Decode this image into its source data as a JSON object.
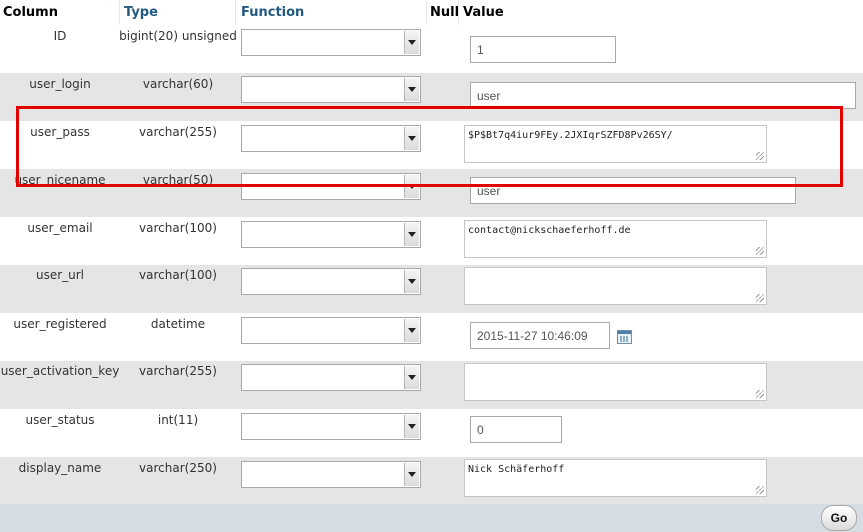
{
  "header": {
    "column": "Column",
    "type": "Type",
    "function": "Function",
    "null": "Null",
    "value": "Value"
  },
  "rows": [
    {
      "name": "ID",
      "type": "bigint(20) unsigned",
      "value": "1",
      "kind": "input"
    },
    {
      "name": "user_login",
      "type": "varchar(60)",
      "value": "user",
      "kind": "input"
    },
    {
      "name": "user_pass",
      "type": "varchar(255)",
      "value": "$P$Bt7q4iur9FEy.2JXIqrSZFD8Pv26SY/",
      "kind": "textarea"
    },
    {
      "name": "user_nicename",
      "type": "varchar(50)",
      "value": "user",
      "kind": "input"
    },
    {
      "name": "user_email",
      "type": "varchar(100)",
      "value": "contact@nickschaeferhoff.de",
      "kind": "textarea"
    },
    {
      "name": "user_url",
      "type": "varchar(100)",
      "value": "",
      "kind": "textarea"
    },
    {
      "name": "user_registered",
      "type": "datetime",
      "value": "2015-11-27 10:46:09",
      "kind": "date"
    },
    {
      "name": "user_activation_key",
      "type": "varchar(255)",
      "value": "",
      "kind": "textarea"
    },
    {
      "name": "user_status",
      "type": "int(11)",
      "value": "0",
      "kind": "input"
    },
    {
      "name": "display_name",
      "type": "varchar(250)",
      "value": "Nick Schäferhoff",
      "kind": "textarea"
    }
  ],
  "footer": {
    "go_label": "Go"
  },
  "colors": {
    "header_link": "#235a81",
    "row_alt": "#e5e5e5",
    "highlight_box": "#e10000",
    "footer_bg": "#d5dce3"
  },
  "icons": {
    "dropdown": "chevron-down-icon",
    "calendar": "calendar-icon",
    "resize": "resize-grip-icon"
  }
}
